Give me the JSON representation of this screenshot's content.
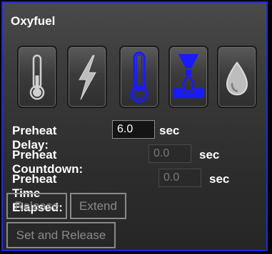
{
  "panel": {
    "title": "Oxyfuel",
    "border_color": "#1f2bd8"
  },
  "mode_buttons": [
    {
      "icon": "thermometer-icon",
      "active": false
    },
    {
      "icon": "lightning-icon",
      "active": false
    },
    {
      "icon": "thermometer-icon",
      "active": true
    },
    {
      "icon": "torch-nozzle-icon",
      "active": true
    },
    {
      "icon": "droplet-icon",
      "active": false
    }
  ],
  "fields": {
    "preheat_delay": {
      "label": "Preheat Delay:",
      "value": "6.0",
      "unit": "sec"
    },
    "preheat_countdown": {
      "label": "Preheat Countdown:",
      "value": "0.0",
      "unit": "sec"
    },
    "preheat_time_elapsed": {
      "label": "Preheat Time Elapsed:",
      "value": "0.0",
      "unit": "sec"
    }
  },
  "actions": {
    "release": "Release",
    "extend": "Extend",
    "set_and_release": "Set and Release"
  },
  "colors": {
    "active_icon": "#1a1aff",
    "inactive_icon": "#c8c8c8"
  }
}
